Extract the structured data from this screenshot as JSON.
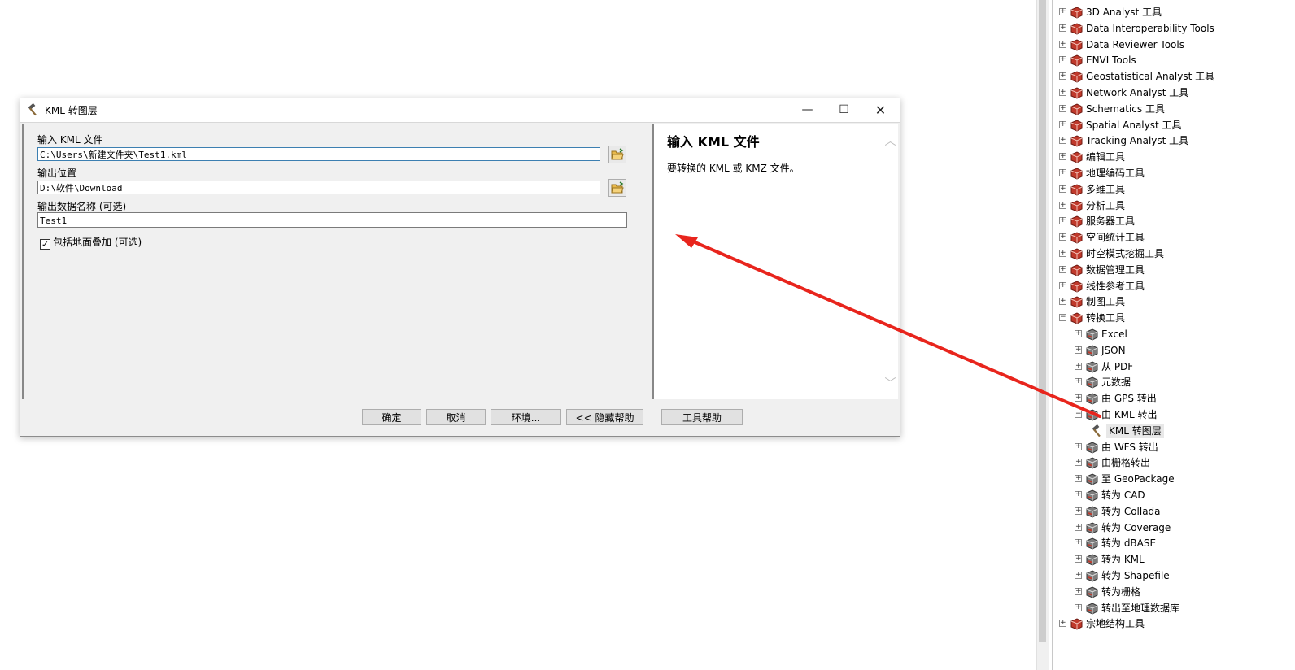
{
  "dialog": {
    "title": "KML 转图层",
    "minimize": "—",
    "maximize": "☐",
    "close": "✕",
    "fields": {
      "input_kml_label": "输入 KML 文件",
      "input_kml_value": "C:\\Users\\新建文件夹\\Test1.kml",
      "output_location_label": "输出位置",
      "output_location_value": "D:\\软件\\Download",
      "output_name_label": "输出数据名称 (可选)",
      "output_name_value": "Test1",
      "include_ground_overlay_label": "包括地面叠加 (可选)",
      "include_ground_overlay_checked": "✓"
    },
    "help": {
      "title": "输入  KML 文件",
      "text": "要转换的 KML 或 KMZ 文件。"
    },
    "buttons": {
      "ok": "确定",
      "cancel": "取消",
      "environments": "环境...",
      "hide_help": "<< 隐藏帮助",
      "tool_help": "工具帮助"
    },
    "scroll_up": "︿",
    "scroll_down": "﹀"
  },
  "tree": {
    "top_level": [
      {
        "label": "3D Analyst 工具",
        "expander": "+"
      },
      {
        "label": "Data Interoperability Tools",
        "expander": "+"
      },
      {
        "label": "Data Reviewer Tools",
        "expander": "+"
      },
      {
        "label": "ENVI Tools",
        "expander": "+"
      },
      {
        "label": "Geostatistical Analyst 工具",
        "expander": "+"
      },
      {
        "label": "Network Analyst 工具",
        "expander": "+"
      },
      {
        "label": "Schematics 工具",
        "expander": "+"
      },
      {
        "label": "Spatial Analyst 工具",
        "expander": "+"
      },
      {
        "label": "Tracking Analyst 工具",
        "expander": "+"
      },
      {
        "label": "编辑工具",
        "expander": "+"
      },
      {
        "label": "地理编码工具",
        "expander": "+"
      },
      {
        "label": "多维工具",
        "expander": "+"
      },
      {
        "label": "分析工具",
        "expander": "+"
      },
      {
        "label": "服务器工具",
        "expander": "+"
      },
      {
        "label": "空间统计工具",
        "expander": "+"
      },
      {
        "label": "时空模式挖掘工具",
        "expander": "+"
      },
      {
        "label": "数据管理工具",
        "expander": "+"
      },
      {
        "label": "线性参考工具",
        "expander": "+"
      },
      {
        "label": "制图工具",
        "expander": "+"
      },
      {
        "label": "转换工具",
        "expander": "−"
      }
    ],
    "conversion_children": [
      {
        "label": "Excel",
        "expander": "+"
      },
      {
        "label": "JSON",
        "expander": "+"
      },
      {
        "label": "从 PDF",
        "expander": "+"
      },
      {
        "label": "元数据",
        "expander": "+"
      },
      {
        "label": "由 GPS 转出",
        "expander": "+"
      },
      {
        "label": "由 KML 转出",
        "expander": "−"
      }
    ],
    "kml_child": "KML 转图层",
    "conversion_children_after": [
      {
        "label": "由 WFS 转出",
        "expander": "+"
      },
      {
        "label": "由栅格转出",
        "expander": "+"
      },
      {
        "label": "至 GeoPackage",
        "expander": "+"
      },
      {
        "label": "转为 CAD",
        "expander": "+"
      },
      {
        "label": "转为 Collada",
        "expander": "+"
      },
      {
        "label": "转为 Coverage",
        "expander": "+"
      },
      {
        "label": "转为 dBASE",
        "expander": "+"
      },
      {
        "label": "转为 KML",
        "expander": "+"
      },
      {
        "label": "转为 Shapefile",
        "expander": "+"
      },
      {
        "label": "转为栅格",
        "expander": "+"
      },
      {
        "label": "转出至地理数据库",
        "expander": "+"
      }
    ],
    "last_top_level": {
      "label": "宗地结构工具",
      "expander": "+"
    }
  },
  "annotation": {
    "arrow_color": "#e8251d"
  },
  "colors": {
    "toolbox_red": "#c0392b",
    "dialog_bg": "#f0f0f0"
  }
}
